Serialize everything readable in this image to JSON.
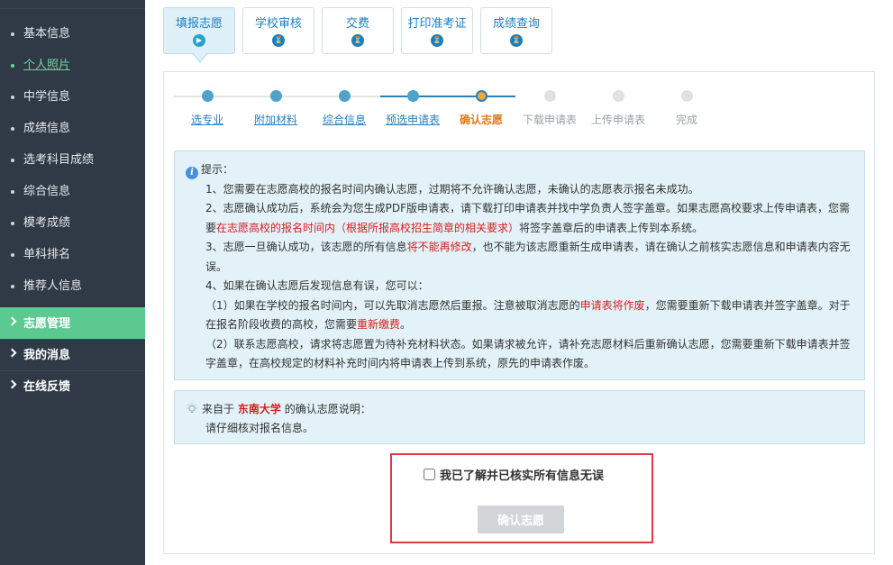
{
  "sidebar": {
    "sub_items": [
      {
        "label": "基本信息"
      },
      {
        "label": "个人照片"
      },
      {
        "label": "中学信息"
      },
      {
        "label": "成绩信息"
      },
      {
        "label": "选考科目成绩"
      },
      {
        "label": "综合信息"
      },
      {
        "label": "模考成绩"
      },
      {
        "label": "单科排名"
      },
      {
        "label": "推荐人信息"
      }
    ],
    "active_sub_item": "个人照片",
    "groups": [
      {
        "label": "志愿管理",
        "active": true
      },
      {
        "label": "我的消息",
        "active": false
      },
      {
        "label": "在线反馈",
        "active": false
      }
    ]
  },
  "tabs": [
    {
      "label": "填报志愿",
      "icon": "play-circle-icon",
      "active": true
    },
    {
      "label": "学校审核",
      "icon": "hourglass-icon",
      "active": false
    },
    {
      "label": "交费",
      "icon": "hourglass-icon",
      "active": false
    },
    {
      "label": "打印准考证",
      "icon": "hourglass-icon",
      "active": false
    },
    {
      "label": "成绩查询",
      "icon": "hourglass-icon",
      "active": false
    }
  ],
  "steps": [
    {
      "label": "选专业",
      "state": "done"
    },
    {
      "label": "附加材料",
      "state": "done"
    },
    {
      "label": "综合信息",
      "state": "done"
    },
    {
      "label": "预选申请表",
      "state": "done"
    },
    {
      "label": "确认志愿",
      "state": "current"
    },
    {
      "label": "下载申请表",
      "state": "todo"
    },
    {
      "label": "上传申请表",
      "state": "todo"
    },
    {
      "label": "完成",
      "state": "todo"
    }
  ],
  "notice": {
    "title": "提示：",
    "item1": "1、您需要在志愿高校的报名时间内确认志愿，过期将不允许确认志愿，未确认的志愿表示报名未成功。",
    "item2_a": "2、志愿确认成功后，系统会为您生成PDF版申请表，请下载打印申请表并找中学负责人签字盖章。如果志愿高校要求上传申请表，您需要",
    "item2_hl": "在志愿高校的报名时间内（根据所报高校招生简章的相关要求）",
    "item2_b": "将签字盖章后的申请表上传到本系统。",
    "item3_a": "3、志愿一旦确认成功，该志愿的所有信息",
    "item3_hl": "将不能再修改",
    "item3_b": "，也不能为该志愿重新生成申请表，请在确认之前核实志愿信息和申请表内容无误。",
    "item4": "4、如果在确认志愿后发现信息有误，您可以：",
    "item4_1a": "（1）如果在学校的报名时间内，可以先取消志愿然后重报。注意被取消志愿的",
    "item4_1hl": "申请表将作废",
    "item4_1b": "，您需要重新下载申请表并签字盖章。对于在报名阶段收费的高校，您需要",
    "item4_1hl2": "重新缴费",
    "item4_1c": "。",
    "item4_2": "（2）联系志愿高校，请求将志愿置为待补充材料状态。如果请求被允许，请补充志愿材料后重新确认志愿，您需要重新下载申请表并签字盖章，在高校规定的材料补充时间内将申请表上传到系统，原先的申请表作废。"
  },
  "school_note": {
    "prefix": "来自于",
    "school": "东南大学",
    "suffix": "的确认志愿说明：",
    "desc": "请仔细核对报名信息。"
  },
  "confirm": {
    "checkbox_label": "我已了解并已核实所有信息无误",
    "button_label": "确认志愿"
  },
  "colors": {
    "sidebar_bg": "#2f3a46",
    "sidebar_active": "#5cc991",
    "link_blue": "#2e7fb8",
    "current_orange": "#e07b1d",
    "highlight_red": "#d81e1e",
    "notice_bg": "#e2f2f8"
  }
}
